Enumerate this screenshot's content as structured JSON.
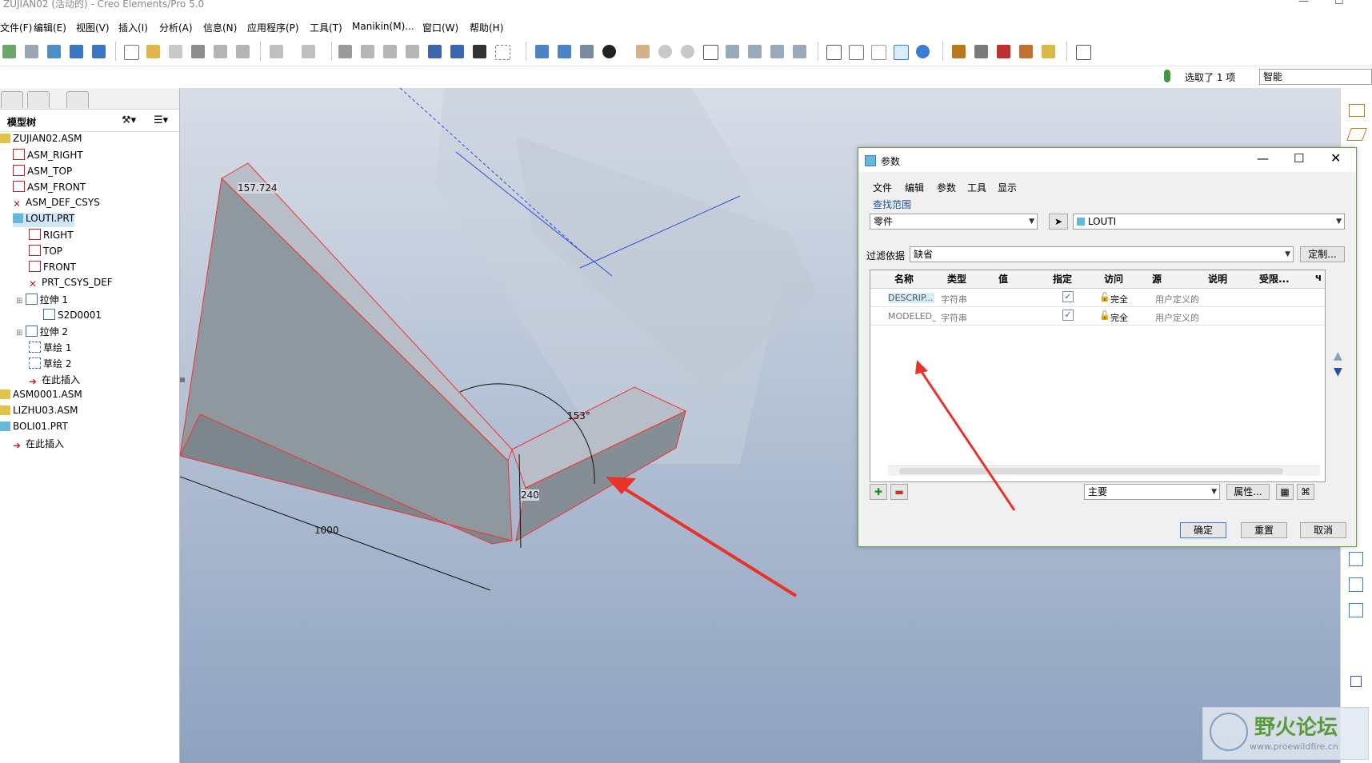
{
  "window": {
    "title": "ZUJIAN02 (活动的) - Creo Elements/Pro 5.0"
  },
  "menu": [
    "文件(F)",
    "编辑(E)",
    "视图(V)",
    "插入(I)",
    "分析(A)",
    "信息(N)",
    "应用程序(P)",
    "工具(T)",
    "Manikin(M)...",
    "窗口(W)",
    "帮助(H)"
  ],
  "status": {
    "selected": "选取了 1 项",
    "filter_value": "智能"
  },
  "model_tree": {
    "title": "模型树",
    "items": [
      {
        "label": "ZUJIAN02.ASM",
        "icon": "assembly-icon"
      },
      {
        "label": "ASM_RIGHT",
        "icon": "datum-plane-icon"
      },
      {
        "label": "ASM_TOP",
        "icon": "datum-plane-icon"
      },
      {
        "label": "ASM_FRONT",
        "icon": "datum-plane-icon"
      },
      {
        "label": "ASM_DEF_CSYS",
        "icon": "csys-icon"
      },
      {
        "label": "LOUTI.PRT",
        "icon": "part-icon"
      },
      {
        "label": "RIGHT",
        "icon": "datum-plane-icon"
      },
      {
        "label": "TOP",
        "icon": "datum-plane-icon"
      },
      {
        "label": "FRONT",
        "icon": "datum-plane-icon"
      },
      {
        "label": "PRT_CSYS_DEF",
        "icon": "csys-icon"
      },
      {
        "label": "拉伸 1",
        "icon": "extrude-icon"
      },
      {
        "label": "S2D0001",
        "icon": "sketch-icon"
      },
      {
        "label": "拉伸 2",
        "icon": "extrude-icon"
      },
      {
        "label": "草绘 1",
        "icon": "sketch-icon"
      },
      {
        "label": "草绘 2",
        "icon": "sketch-icon"
      },
      {
        "label": "在此插入",
        "icon": "insert-here-icon"
      },
      {
        "label": "ASM0001.ASM",
        "icon": "assembly-icon"
      },
      {
        "label": "LIZHU03.ASM",
        "icon": "assembly-icon"
      },
      {
        "label": "BOLI01.PRT",
        "icon": "part-icon"
      },
      {
        "label": "在此插入",
        "icon": "insert-here-icon"
      }
    ]
  },
  "dimensions": {
    "d1": "157.724",
    "d2": "153°",
    "d3": "240",
    "d4": "1000"
  },
  "dialog": {
    "title": "参数",
    "menu": [
      "文件",
      "编辑",
      "参数",
      "工具",
      "显示"
    ],
    "scope_label": "查找范围",
    "scope_type": "零件",
    "scope_object": "LOUTI",
    "filter_label": "过滤依据",
    "filter_value": "缺省",
    "customize": "定制...",
    "columns": [
      "名称",
      "类型",
      "值",
      "指定",
      "访问",
      "源",
      "说明",
      "受限...",
      "ч"
    ],
    "rows": [
      {
        "name": "DESCRIP...",
        "type": "字符串",
        "value": "",
        "designated": true,
        "access": "完全",
        "source": "用户定义的"
      },
      {
        "name": "MODELED_BY",
        "type": "字符串",
        "value": "",
        "designated": true,
        "access": "完全",
        "source": "用户定义的"
      }
    ],
    "main_select": "主要",
    "properties": "属性...",
    "ok": "确定",
    "reset": "重置",
    "cancel": "取消"
  },
  "watermark": {
    "name": "野火论坛",
    "url": "www.proewildfire.cn"
  }
}
